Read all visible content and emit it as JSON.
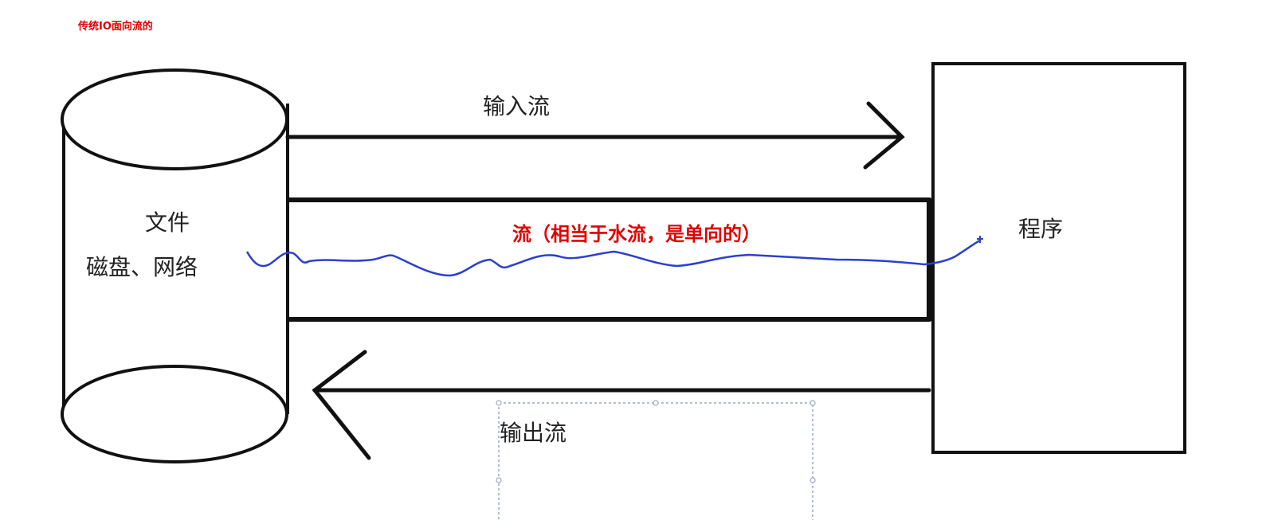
{
  "header": {
    "title": "传统IO面向流的",
    "color": "#e00000"
  },
  "source": {
    "line1": "文件",
    "line2": "磁盘、网络"
  },
  "program": {
    "label": "程序"
  },
  "input_stream": {
    "label": "输入流"
  },
  "output_stream": {
    "label": "输出流"
  },
  "stream": {
    "label": "流（相当于水流，是单向的）",
    "color": "#e00000"
  },
  "colors": {
    "stroke": "#111111",
    "water": "#2b3fd1",
    "selection": "#9aa8c0"
  }
}
